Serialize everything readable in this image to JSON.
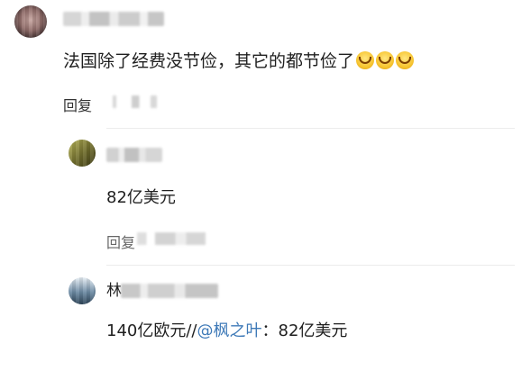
{
  "comment": {
    "text": "法国除了经费没节俭，其它的都节俭了",
    "emoji": [
      "grin-emoji",
      "grin-emoji",
      "grin-emoji"
    ],
    "reply_label": "回复"
  },
  "replies": [
    {
      "text": "82亿美元",
      "reply_label": "回复"
    },
    {
      "name_visible_char": "林",
      "text_prefix": "140亿欧元//",
      "mention": "@枫之叶",
      "text_suffix": "：82亿美元"
    }
  ],
  "colors": {
    "background": "#ffffff",
    "text": "#1f1f1f",
    "mention": "#3f7ab8",
    "emoji": "#f7c531"
  }
}
